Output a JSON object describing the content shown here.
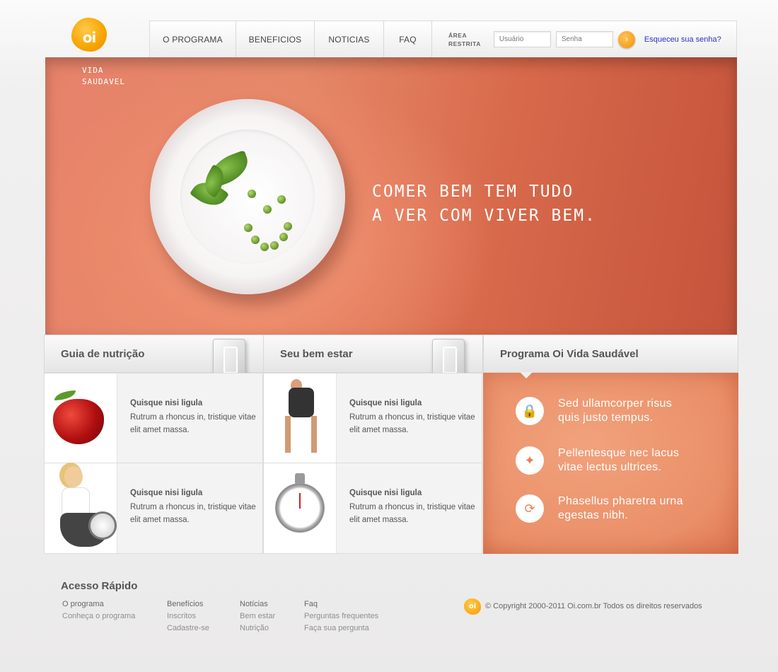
{
  "header": {
    "logo_text": "oi",
    "brand_line1": "VIDA",
    "brand_line2": "SAUDAVEL",
    "nav": [
      "O PROGRAMA",
      "BENEFICIOS",
      "NOTICIAS",
      "FAQ"
    ],
    "active_nav": "BENEFICIOS",
    "area_label_1": "ÁREA",
    "area_label_2": "RESTRITA",
    "user_placeholder": "Usuário",
    "pass_placeholder": "Senha",
    "go_icon": "›",
    "forgot_link": "Esqueceu sua senha?"
  },
  "hero": {
    "line1": "COMER BEM TEM TUDO",
    "line2": "A VER COM VIVER BEM."
  },
  "sections": {
    "nutrition_title": "Guia de nutrição",
    "wellbeing_title": "Seu bem estar",
    "program_title": "Programa Oi Vida Saudável"
  },
  "tiles": [
    {
      "title": "Quisque nisi ligula",
      "body": "Rutrum a rhoncus in, tristique vitae elit amet massa.",
      "image": "apple"
    },
    {
      "title": "Quisque nisi ligula",
      "body": "Rutrum a rhoncus in, tristique vitae elit amet massa.",
      "image": "runner"
    },
    {
      "title": "Quisque nisi ligula",
      "body": "Rutrum a rhoncus in, tristique vitae elit amet massa.",
      "image": "woman-with-scale"
    },
    {
      "title": "Quisque nisi ligula",
      "body": "Rutrum a rhoncus in, tristique vitae elit amet massa.",
      "image": "stopwatch"
    }
  ],
  "program_items": [
    {
      "icon": "lock-icon",
      "glyph": "🔒",
      "text": "Sed ullamcorper risus quis justo tempus."
    },
    {
      "icon": "star-icon",
      "glyph": "✦",
      "text": "Pellentesque nec lacus vitae lectus ultrices."
    },
    {
      "icon": "refresh-icon",
      "glyph": "⟳",
      "text": "Phasellus pharetra urna egestas nibh."
    }
  ],
  "footer": {
    "title": "Acesso Rápido",
    "col1": [
      "O programa",
      "Conheça o programa"
    ],
    "col2": [
      "Benefícios",
      "Inscritos",
      "Cadastre-se"
    ],
    "col3": [
      "Notícias",
      "Bem estar",
      "Nutrição"
    ],
    "col4": [
      "Faq",
      "Perguntas frequentes",
      "Faça sua pergunta"
    ],
    "logo_text": "oi",
    "copyright": "© Copyright 2000-2011 Oi.com.br Todos os direitos reservados"
  },
  "colors": {
    "accent": "#f59d00",
    "hero": "#e07a5d",
    "program_panel": "#ea8f68",
    "link": "#2d31c5"
  }
}
